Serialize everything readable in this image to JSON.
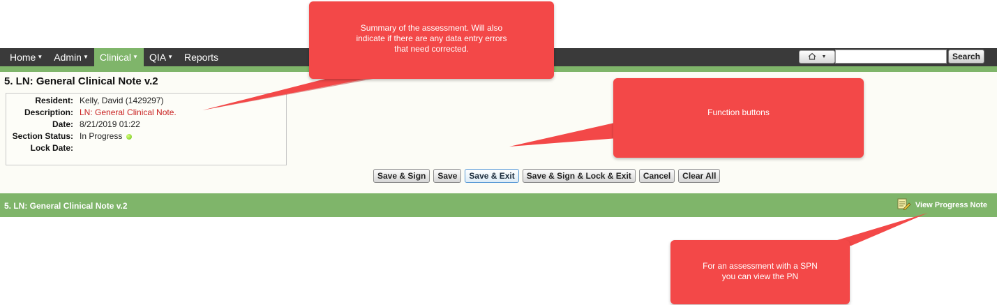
{
  "nav": {
    "items": [
      {
        "label": "Home",
        "caret": true,
        "active": false
      },
      {
        "label": "Admin",
        "caret": true,
        "active": false
      },
      {
        "label": "Clinical",
        "caret": true,
        "active": true
      },
      {
        "label": "QIA",
        "caret": true,
        "active": false
      },
      {
        "label": "Reports",
        "caret": false,
        "active": false
      }
    ],
    "home_icon": "home-icon",
    "search_value": "",
    "search_button": "Search"
  },
  "page": {
    "title": "5. LN: General Clinical Note v.2"
  },
  "summary": {
    "resident_label": "Resident:",
    "resident_value": "Kelly, David (1429297)",
    "description_label": "Description:",
    "description_value": "LN: General Clinical Note.",
    "date_label": "Date:",
    "date_value": "8/21/2019 01:22",
    "status_label": "Section Status:",
    "status_value": "In Progress",
    "lock_label": "Lock Date:",
    "lock_value": ""
  },
  "buttons": {
    "save_sign": "Save & Sign",
    "save": "Save",
    "save_exit": "Save & Exit",
    "save_sign_lock_exit": "Save & Sign & Lock & Exit",
    "cancel": "Cancel",
    "clear_all": "Clear All"
  },
  "section": {
    "title": "5. LN: General Clinical Note v.2",
    "view_progress_note": "View Progress Note"
  },
  "callouts": {
    "summary_line1": "Summary of the assessment. Will also",
    "summary_line2": "indicate if there are any data entry errors",
    "summary_line3": "that need corrected.",
    "function": "Function buttons",
    "pn_line1": "For an assessment with a SPN",
    "pn_line2": "you can view the PN"
  },
  "colors": {
    "nav_bg": "#3a3a3a",
    "accent_green": "#7fb56a",
    "callout_red": "#f34848",
    "description_red": "#c81e1e"
  }
}
